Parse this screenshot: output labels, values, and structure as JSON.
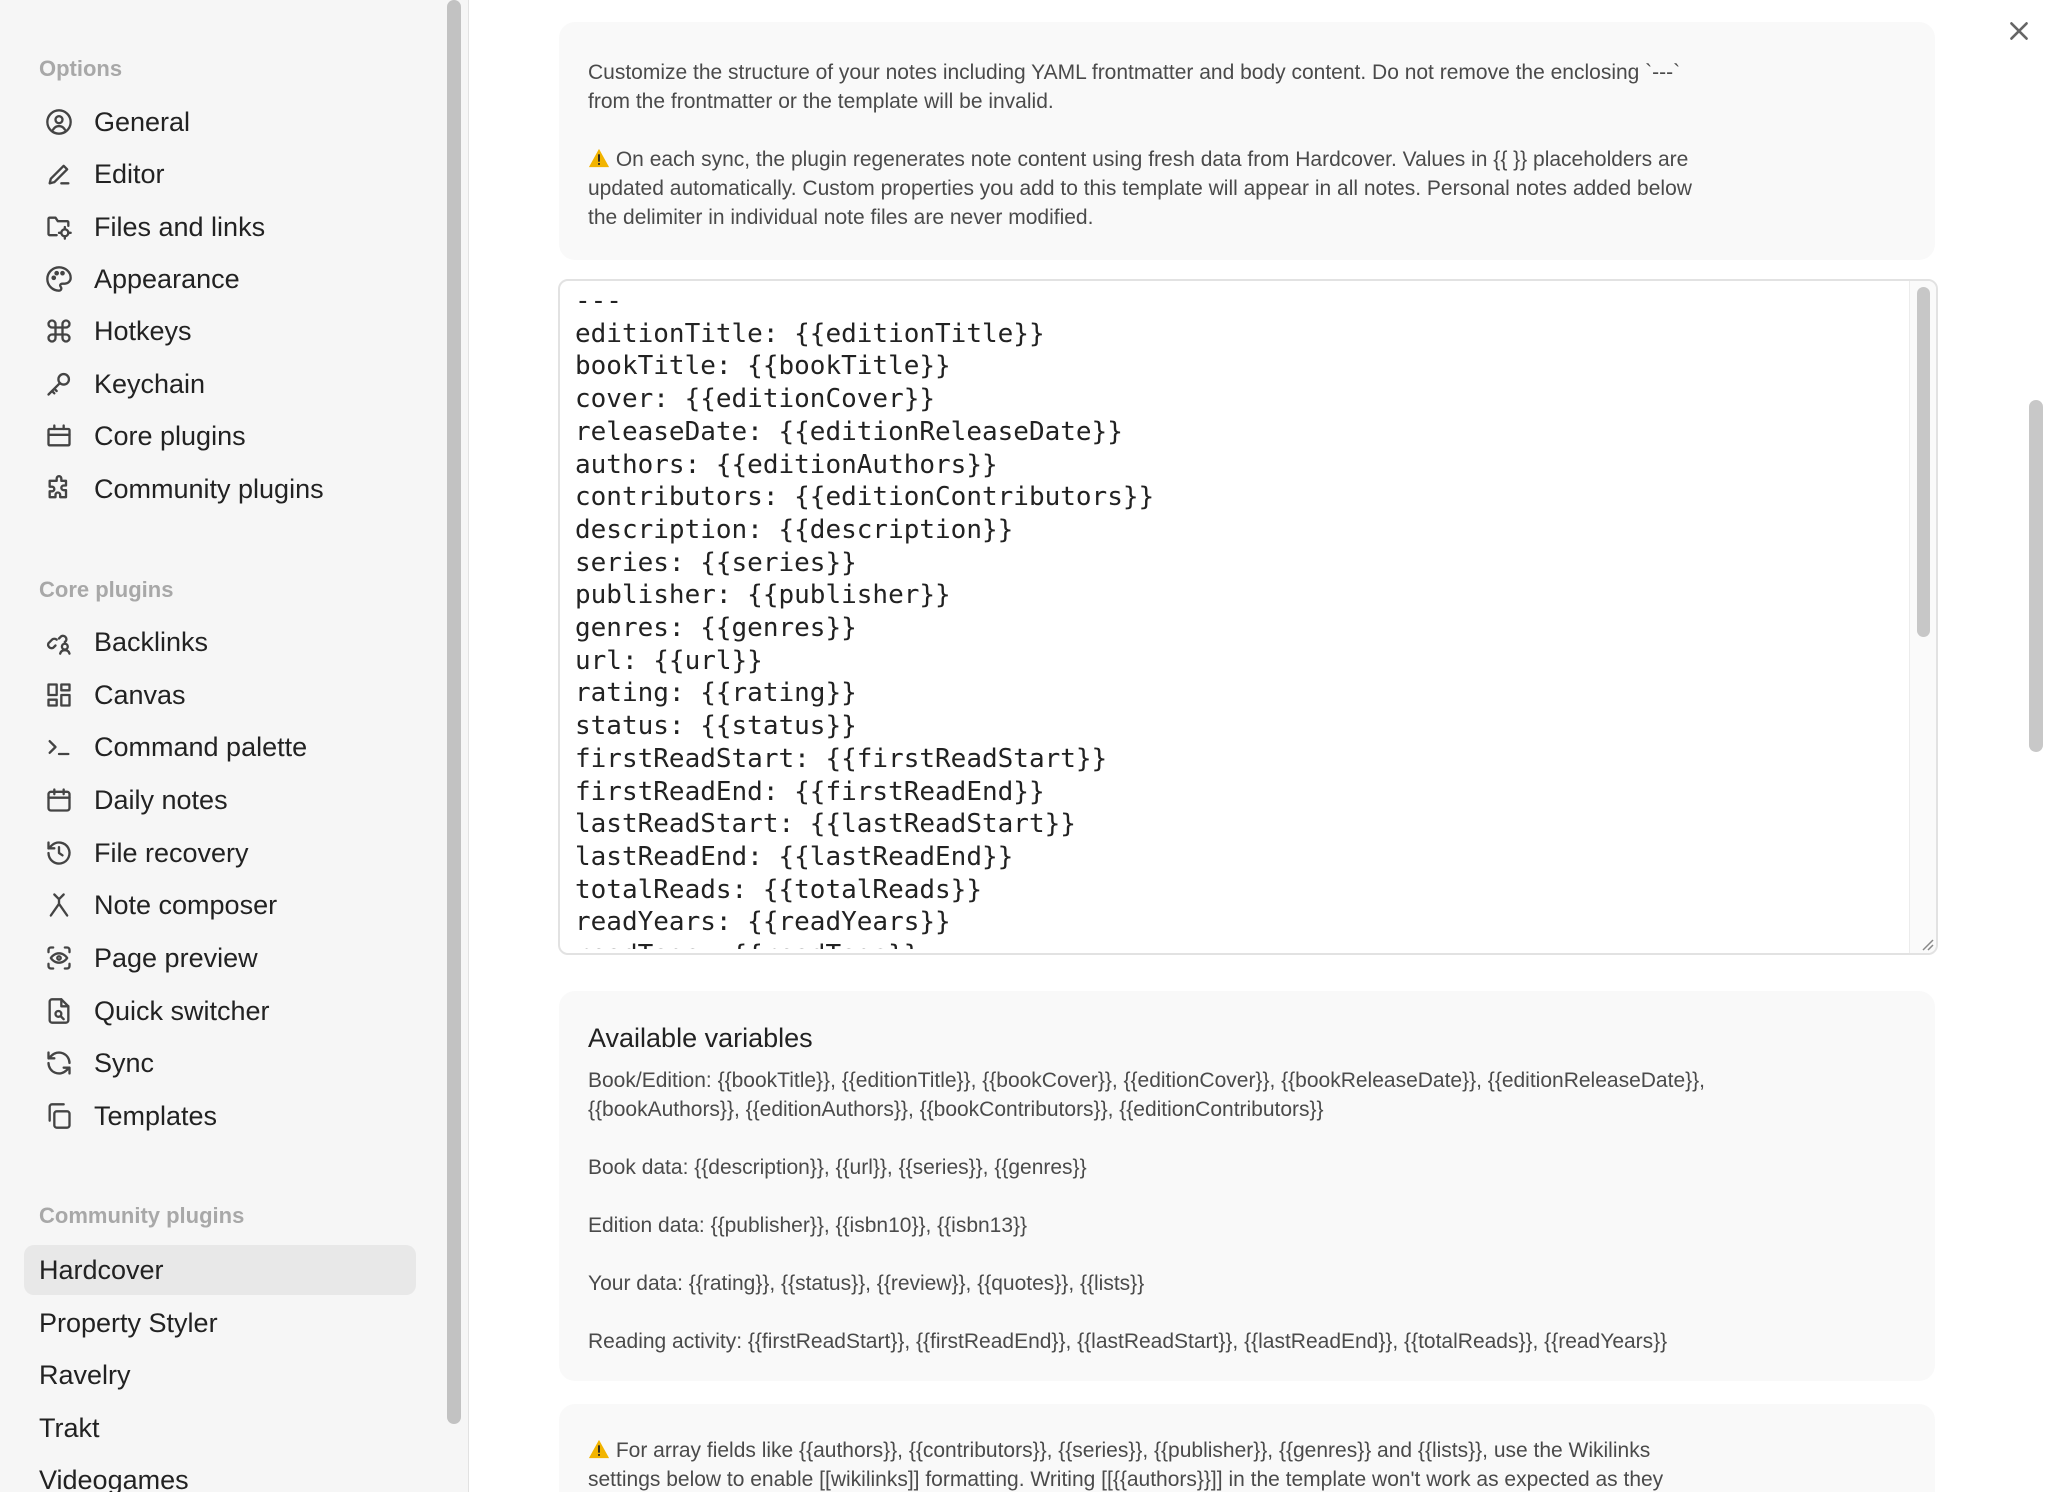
{
  "sidebar": {
    "options_label": "Options",
    "options": [
      {
        "label": "General",
        "icon": "user-circle-icon"
      },
      {
        "label": "Editor",
        "icon": "pencil-icon"
      },
      {
        "label": "Files and links",
        "icon": "folder-cog-icon"
      },
      {
        "label": "Appearance",
        "icon": "palette-icon"
      },
      {
        "label": "Hotkeys",
        "icon": "command-icon"
      },
      {
        "label": "Keychain",
        "icon": "key-icon"
      },
      {
        "label": "Core plugins",
        "icon": "plug-box-icon"
      },
      {
        "label": "Community plugins",
        "icon": "puzzle-icon"
      }
    ],
    "core_label": "Core plugins",
    "core": [
      {
        "label": "Backlinks",
        "icon": "link-user-icon"
      },
      {
        "label": "Canvas",
        "icon": "layout-dashboard-icon"
      },
      {
        "label": "Command palette",
        "icon": "terminal-icon"
      },
      {
        "label": "Daily notes",
        "icon": "calendar-icon"
      },
      {
        "label": "File recovery",
        "icon": "history-icon"
      },
      {
        "label": "Note composer",
        "icon": "merge-icon"
      },
      {
        "label": "Page preview",
        "icon": "eye-scan-icon"
      },
      {
        "label": "Quick switcher",
        "icon": "file-search-icon"
      },
      {
        "label": "Sync",
        "icon": "refresh-icon"
      },
      {
        "label": "Templates",
        "icon": "copy-icon"
      }
    ],
    "community_label": "Community plugins",
    "community": [
      {
        "label": "Hardcover",
        "active": true
      },
      {
        "label": "Property Styler"
      },
      {
        "label": "Ravelry"
      },
      {
        "label": "Trakt"
      },
      {
        "label": "Videogames"
      }
    ]
  },
  "main": {
    "intro_1": "Customize the structure of your notes including YAML frontmatter and body content. Do not remove the enclosing `---`",
    "intro_2": "from the frontmatter or the template will be invalid.",
    "warn_1": "On each sync, the plugin regenerates note content using fresh data from Hardcover. Values in {{ }} placeholders are",
    "warn_2": "updated automatically. Custom properties you add to this template will appear in all notes. Personal notes added below",
    "warn_3": "the delimiter in individual note files are never modified.",
    "warn_icon": "warning-icon",
    "template_lines": [
      "---",
      "editionTitle: {{editionTitle}}",
      "bookTitle: {{bookTitle}}",
      "cover: {{editionCover}}",
      "releaseDate: {{editionReleaseDate}}",
      "authors: {{editionAuthors}}",
      "contributors: {{editionContributors}}",
      "description: {{description}}",
      "series: {{series}}",
      "publisher: {{publisher}}",
      "genres: {{genres}}",
      "url: {{url}}",
      "rating: {{rating}}",
      "status: {{status}}",
      "firstReadStart: {{firstReadStart}}",
      "firstReadEnd: {{firstReadEnd}}",
      "lastReadStart: {{lastReadStart}}",
      "lastReadEnd: {{lastReadEnd}}",
      "totalReads: {{totalReads}}",
      "readYears: {{readYears}}",
      "readTags: {{readTags}}"
    ],
    "vars_title": "Available variables",
    "vars_book_1": "Book/Edition: {{bookTitle}}, {{editionTitle}}, {{bookCover}}, {{editionCover}}, {{bookReleaseDate}}, {{editionReleaseDate}},",
    "vars_book_2": "{{bookAuthors}}, {{editionAuthors}}, {{bookContributors}}, {{editionContributors}}",
    "vars_bookdata": "Book data: {{description}}, {{url}}, {{series}}, {{genres}}",
    "vars_edition": "Edition data: {{publisher}}, {{isbn10}}, {{isbn13}}",
    "vars_your": "Your data: {{rating}}, {{status}}, {{review}}, {{quotes}}, {{lists}}",
    "vars_reading": "Reading activity: {{firstReadStart}}, {{firstReadEnd}}, {{lastReadStart}}, {{lastReadEnd}}, {{totalReads}}, {{readYears}}",
    "array_1": "For array fields like {{authors}}, {{contributors}}, {{series}}, {{publisher}}, {{genres}} and {{lists}}, use the Wikilinks",
    "array_2": "settings below to enable [[wikilinks]] formatting. Writing [[{{authors}}]] in the template won't work as expected as they"
  },
  "colors": {
    "sidebar_bg": "#f6f6f6",
    "active_item_bg": "#e8e8e8",
    "section_label": "#a8a8a8",
    "warning": "#f2b400"
  }
}
